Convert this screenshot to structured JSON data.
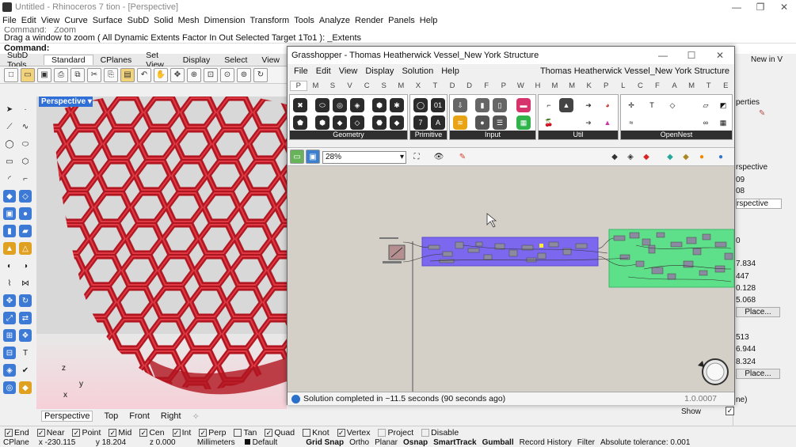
{
  "window": {
    "title": "Untitled - Rhinoceros 7 tion - [Perspective]"
  },
  "menu": [
    "File",
    "Edit",
    "View",
    "Curve",
    "Surface",
    "SubD",
    "Solid",
    "Mesh",
    "Dimension",
    "Transform",
    "Tools",
    "Analyze",
    "Render",
    "Panels",
    "Help"
  ],
  "command": {
    "history": "Command: _Zoom",
    "prompt": "Drag a window to zoom ( All Dynamic Extents Factor In Out Selected Target 1To1 ): _Extents",
    "label": "Command:"
  },
  "toolbar_tabs": [
    "SubD Tools",
    "Standard",
    "CPlanes",
    "Set View",
    "Display",
    "Select",
    "View"
  ],
  "viewport": {
    "label": "Perspective",
    "axis_z": "z",
    "axis_y": "y",
    "axis_x": "x"
  },
  "viewport_tabs": [
    "Perspective",
    "Top",
    "Front",
    "Right"
  ],
  "osnaps": [
    {
      "label": "End",
      "checked": true
    },
    {
      "label": "Near",
      "checked": true
    },
    {
      "label": "Point",
      "checked": true
    },
    {
      "label": "Mid",
      "checked": true
    },
    {
      "label": "Cen",
      "checked": true
    },
    {
      "label": "Int",
      "checked": true
    },
    {
      "label": "Perp",
      "checked": true
    },
    {
      "label": "Tan",
      "checked": false
    },
    {
      "label": "Quad",
      "checked": true
    },
    {
      "label": "Knot",
      "checked": false
    },
    {
      "label": "Vertex",
      "checked": true
    },
    {
      "label": "Project",
      "checked": false
    },
    {
      "label": "Disable",
      "checked": false
    }
  ],
  "status": {
    "cplane": "CPlane",
    "x": "x -230.115",
    "y": "y 18.204",
    "z": "z 0.000",
    "units": "Millimeters",
    "layer": "Default",
    "toggles": [
      "Grid Snap",
      "Ortho",
      "Planar",
      "Osnap",
      "SmartTrack",
      "Gumball",
      "Record History",
      "Filter",
      "Absolute tolerance: 0.001"
    ]
  },
  "rightpanel": {
    "newin": "New in V",
    "properties": "perties",
    "values": [
      "rspective",
      "09",
      "08",
      "rspective",
      "0",
      "7.834",
      "447",
      "0.128",
      "5.068",
      "Place...",
      "513",
      "6.944",
      "8.324",
      "Place...",
      "ne)",
      "Show"
    ]
  },
  "grasshopper": {
    "title": "Grasshopper - Thomas Heatherwick Vessel_New York Structure",
    "doc": "Thomas Heatherwick Vessel_New York Structure",
    "menu": [
      "File",
      "Edit",
      "View",
      "Display",
      "Solution",
      "Help"
    ],
    "tabs": [
      "P",
      "M",
      "S",
      "V",
      "C",
      "S",
      "M",
      "X",
      "T",
      "D",
      "D",
      "F",
      "P",
      "W",
      "H",
      "M",
      "M",
      "K",
      "P",
      "L",
      "C",
      "F",
      "A",
      "M",
      "T",
      "E"
    ],
    "groups": [
      "Geometry",
      "Primitive",
      "Input",
      "Util",
      "OpenNest"
    ],
    "zoom": "28%",
    "status": "Solution completed in ~11.5 seconds (90 seconds ago)",
    "version": "1.0.0007"
  }
}
